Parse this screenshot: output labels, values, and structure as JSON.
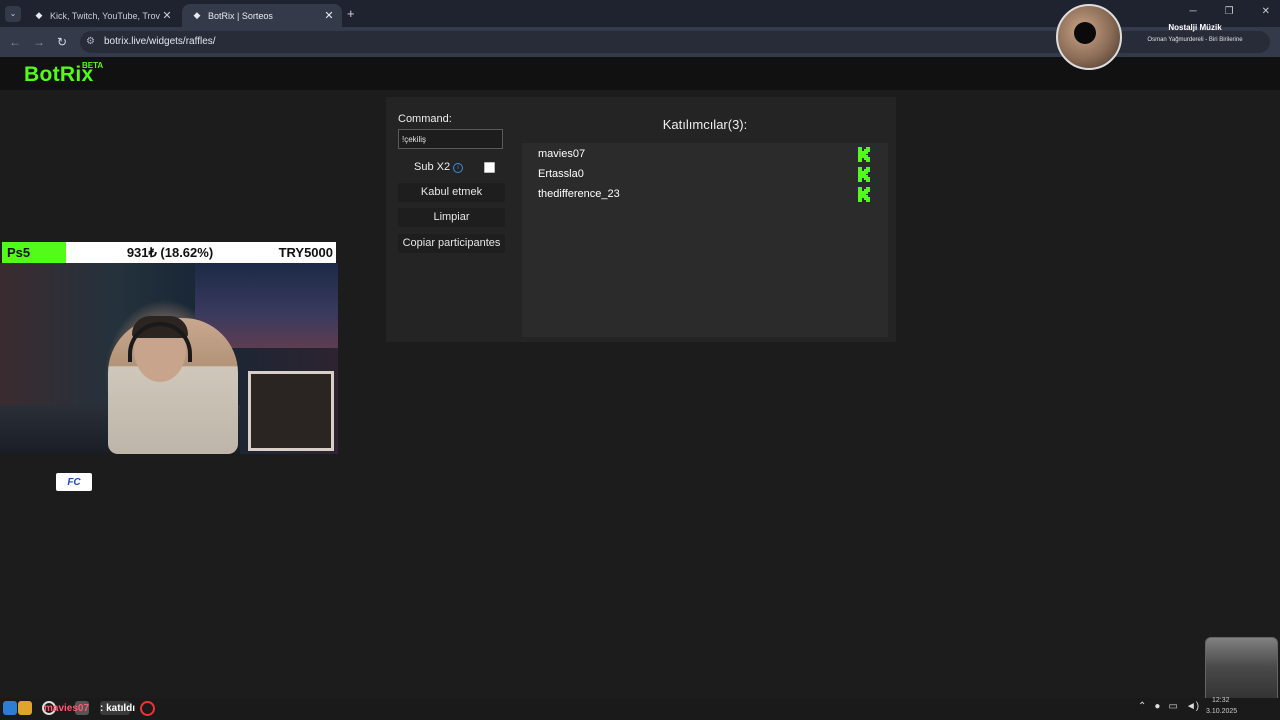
{
  "browser": {
    "tabs": [
      {
        "title": "Kick, Twitch, YouTube, Trovo ve",
        "active": false
      },
      {
        "title": "BotRix | Sorteos",
        "active": true
      }
    ],
    "url": "botrix.live/widgets/raffles/"
  },
  "brand": {
    "logo": "BotRix",
    "badge": "BETA",
    "accent": "#53fc18"
  },
  "media": {
    "title": "Nostalji Müzik",
    "subtitle": "Osman Yağmurdereli - Biri Birilerine"
  },
  "raffle": {
    "command_label": "Command:",
    "command_value": "!çekiliş",
    "sub_label": "Sub X2",
    "sub_checked": false,
    "buttons": {
      "accept": "Kabul etmek",
      "clear": "Limpiar",
      "copy": "Copiar participantes"
    },
    "participants_title": "Katılımcılar(3):",
    "participants": [
      {
        "name": "mavies07",
        "platform": "kick-icon"
      },
      {
        "name": "Ertassla0",
        "platform": "kick-icon"
      },
      {
        "name": "thedifference_23",
        "platform": "kick-icon"
      }
    ]
  },
  "goal": {
    "name": "Ps5",
    "progress_text": "931₺ (18.62%)",
    "progress_fraction": 0.1862,
    "target": "TRY5000"
  },
  "chat": {
    "user": "mavies07",
    "separator": " : ",
    "message": "katıldı"
  },
  "clock": {
    "time": "12:32",
    "date": "3.10.2025"
  }
}
